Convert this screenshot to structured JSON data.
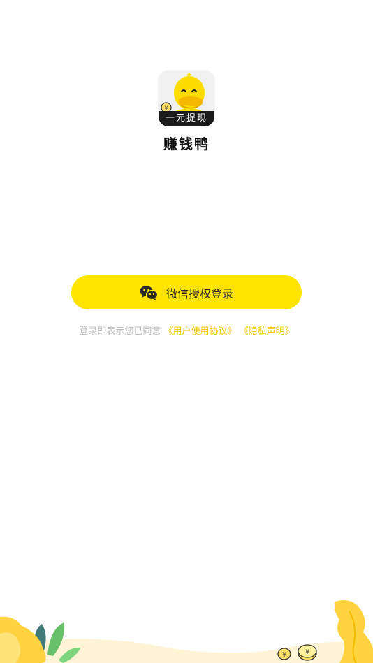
{
  "app": {
    "icon_name": "duck-app-icon",
    "icon_banner": "一元提现",
    "name": "赚钱鸭"
  },
  "login": {
    "button_label": "微信授权登录",
    "icon": "wechat-icon"
  },
  "agreement": {
    "prefix": "登录即表示您已同意",
    "user_agreement_link": "《用户使用协议》",
    "privacy_link": "《隐私声明》"
  },
  "colors": {
    "accent": "#ffe400",
    "link": "#f5c400",
    "muted": "#bdbdbd"
  }
}
